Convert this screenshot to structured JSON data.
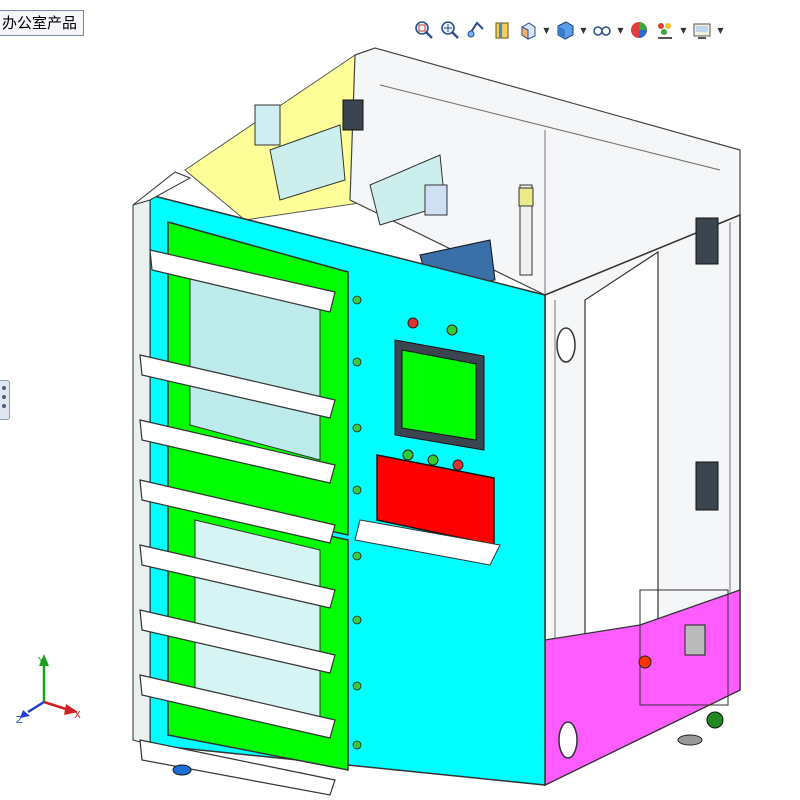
{
  "window": {
    "title_tab": "办公室产品"
  },
  "toolbar": {
    "buttons": [
      {
        "name": "zoom-to-fit",
        "icon": "zoom-to-fit-icon",
        "has_caret": false
      },
      {
        "name": "zoom-to-area",
        "icon": "zoom-to-area-icon",
        "has_caret": false
      },
      {
        "name": "previous-view",
        "icon": "previous-view-icon",
        "has_caret": false
      },
      {
        "name": "section-view",
        "icon": "section-view-icon",
        "has_caret": false
      },
      {
        "name": "view-orientation",
        "icon": "view-orientation-icon",
        "has_caret": true
      },
      {
        "name": "display-style",
        "icon": "display-style-icon",
        "has_caret": true
      },
      {
        "name": "hide-show-items",
        "icon": "hide-show-icon",
        "has_caret": true
      },
      {
        "name": "edit-appearance",
        "icon": "appearance-icon",
        "has_caret": false
      },
      {
        "name": "apply-scene",
        "icon": "scene-icon",
        "has_caret": true
      },
      {
        "name": "view-settings",
        "icon": "view-settings-icon",
        "has_caret": true
      }
    ]
  },
  "triad": {
    "x_label": "X",
    "y_label": "Y",
    "z_label": "Z"
  },
  "model": {
    "front_panel_color": "#00ffff",
    "door_color": "#00ff00",
    "base_color": "#ff5cff",
    "top_color": "#ffff99",
    "control_box_color": "#ff0000",
    "screen_color": "#00ff00"
  }
}
